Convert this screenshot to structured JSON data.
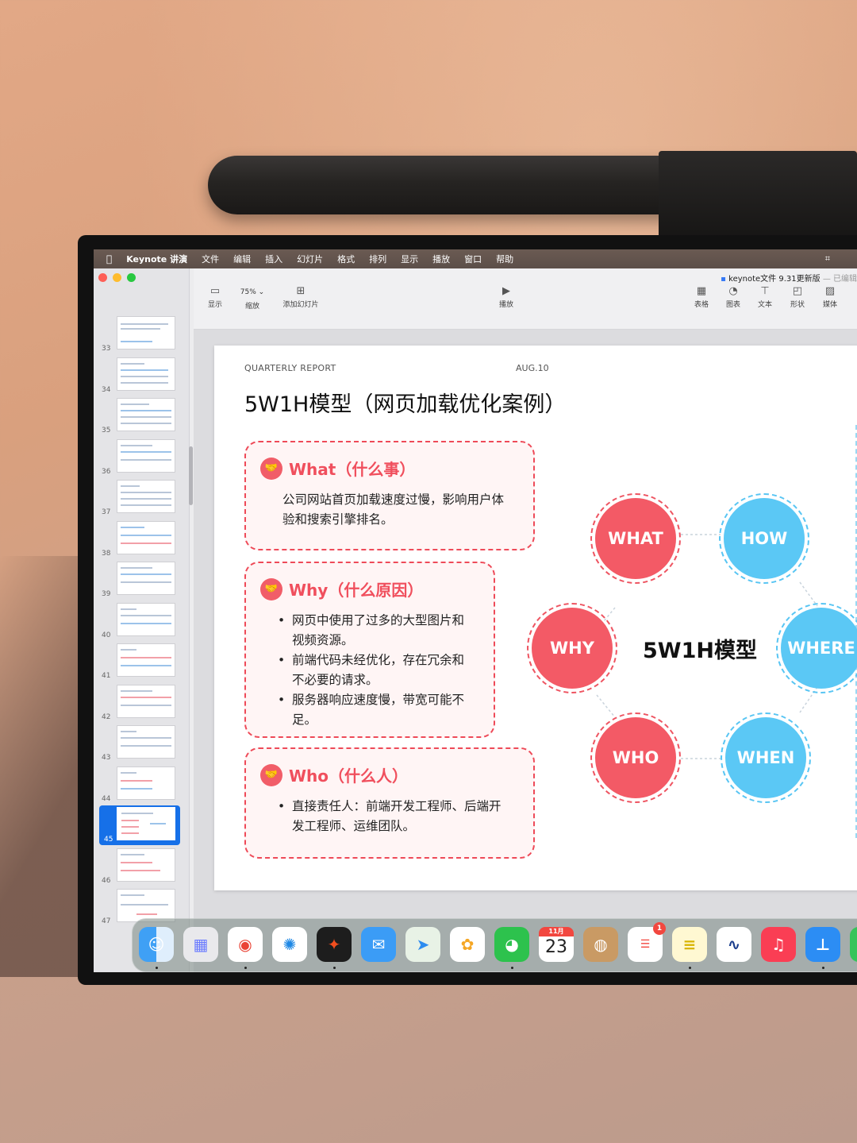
{
  "menubar": {
    "app": "Keynote 讲演",
    "items": [
      "文件",
      "编辑",
      "插入",
      "幻灯片",
      "格式",
      "排列",
      "显示",
      "播放",
      "窗口",
      "帮助"
    ]
  },
  "toolbar": {
    "view_label": "显示",
    "zoom_value": "75% ⌄",
    "zoom_label": "缩放",
    "add_slide_label": "添加幻灯片",
    "play_label": "播放",
    "table_label": "表格",
    "chart_label": "图表",
    "text_label": "文本",
    "shape_label": "形状",
    "media_label": "媒体"
  },
  "document": {
    "title": "keynote文件 9.31更新版",
    "status": "— 已编辑"
  },
  "sidebar": {
    "slide_numbers": [
      "33",
      "34",
      "35",
      "36",
      "37",
      "38",
      "39",
      "40",
      "41",
      "42",
      "43",
      "44",
      "45",
      "46",
      "47"
    ],
    "selected": "45"
  },
  "slide": {
    "report": "QUARTERLY REPORT",
    "date": "AUG.10",
    "title": "5W1H模型（网页加载优化案例）",
    "what": {
      "heading": "What（什么事）",
      "body": "公司网站首页加载速度过慢，影响用户体验和搜索引擎排名。"
    },
    "why": {
      "heading": "Why（什么原因）",
      "bullets": [
        "网页中使用了过多的大型图片和视频资源。",
        "前端代码未经优化，存在冗余和不必要的请求。",
        "服务器响应速度慢，带宽可能不足。"
      ]
    },
    "who": {
      "heading": "Who（什么人）",
      "bullets": [
        "直接责任人：前端开发工程师、后端开发工程师、运维团队。"
      ]
    },
    "diagram": {
      "center": "5W1H模型",
      "nodes": [
        "WHAT",
        "HOW",
        "WHY",
        "WHERE",
        "WHO",
        "WHEN"
      ]
    }
  },
  "dock": {
    "calendar_month": "11月",
    "calendar_day": "23",
    "reminders_badge": "1"
  },
  "colors": {
    "red": "#f35a66",
    "blue": "#5bc8f5",
    "selection": "#1670e8"
  }
}
